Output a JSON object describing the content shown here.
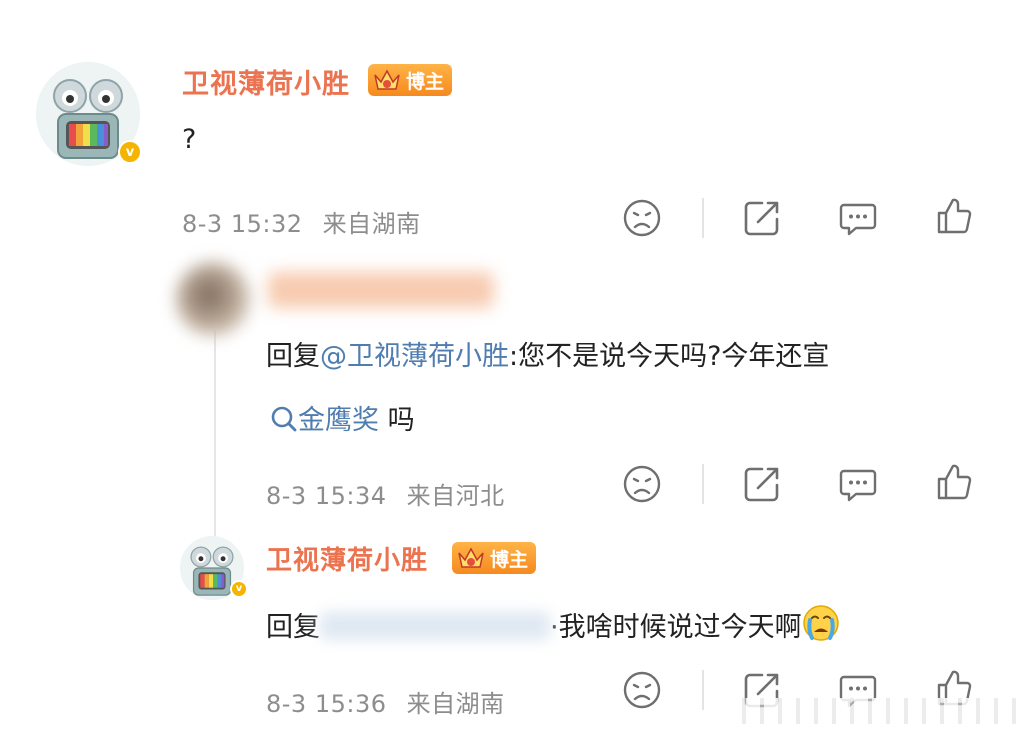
{
  "comment": {
    "username": "卫视薄荷小胜",
    "badge_label": "博主",
    "verified_mark": "v",
    "text": "?",
    "time": "8-3 15:32",
    "location": "来自湖南"
  },
  "reply1": {
    "prefix": "回复",
    "mention": "@卫视薄荷小胜",
    "text_line1": ":您不是说今天吗?今年还宣",
    "topic": "金鹰奖",
    "text_line2": " 吗",
    "time": "8-3 15:34",
    "location": "来自河北"
  },
  "reply2": {
    "username": "卫视薄荷小胜",
    "badge_label": "博主",
    "verified_mark": "v",
    "prefix": "回复",
    "text": "·我啥时候说过今天啊",
    "time": "8-3 15:36",
    "location": "来自湖南"
  },
  "icons": {
    "dislike": "frown-face-icon",
    "share": "share-icon",
    "comment": "comment-bubble-icon",
    "like": "thumbs-up-icon",
    "search": "search-icon"
  },
  "colors": {
    "username": "#eb7350",
    "link": "#507daf",
    "meta": "#8d8d8d",
    "badge": "#f58a1f"
  }
}
